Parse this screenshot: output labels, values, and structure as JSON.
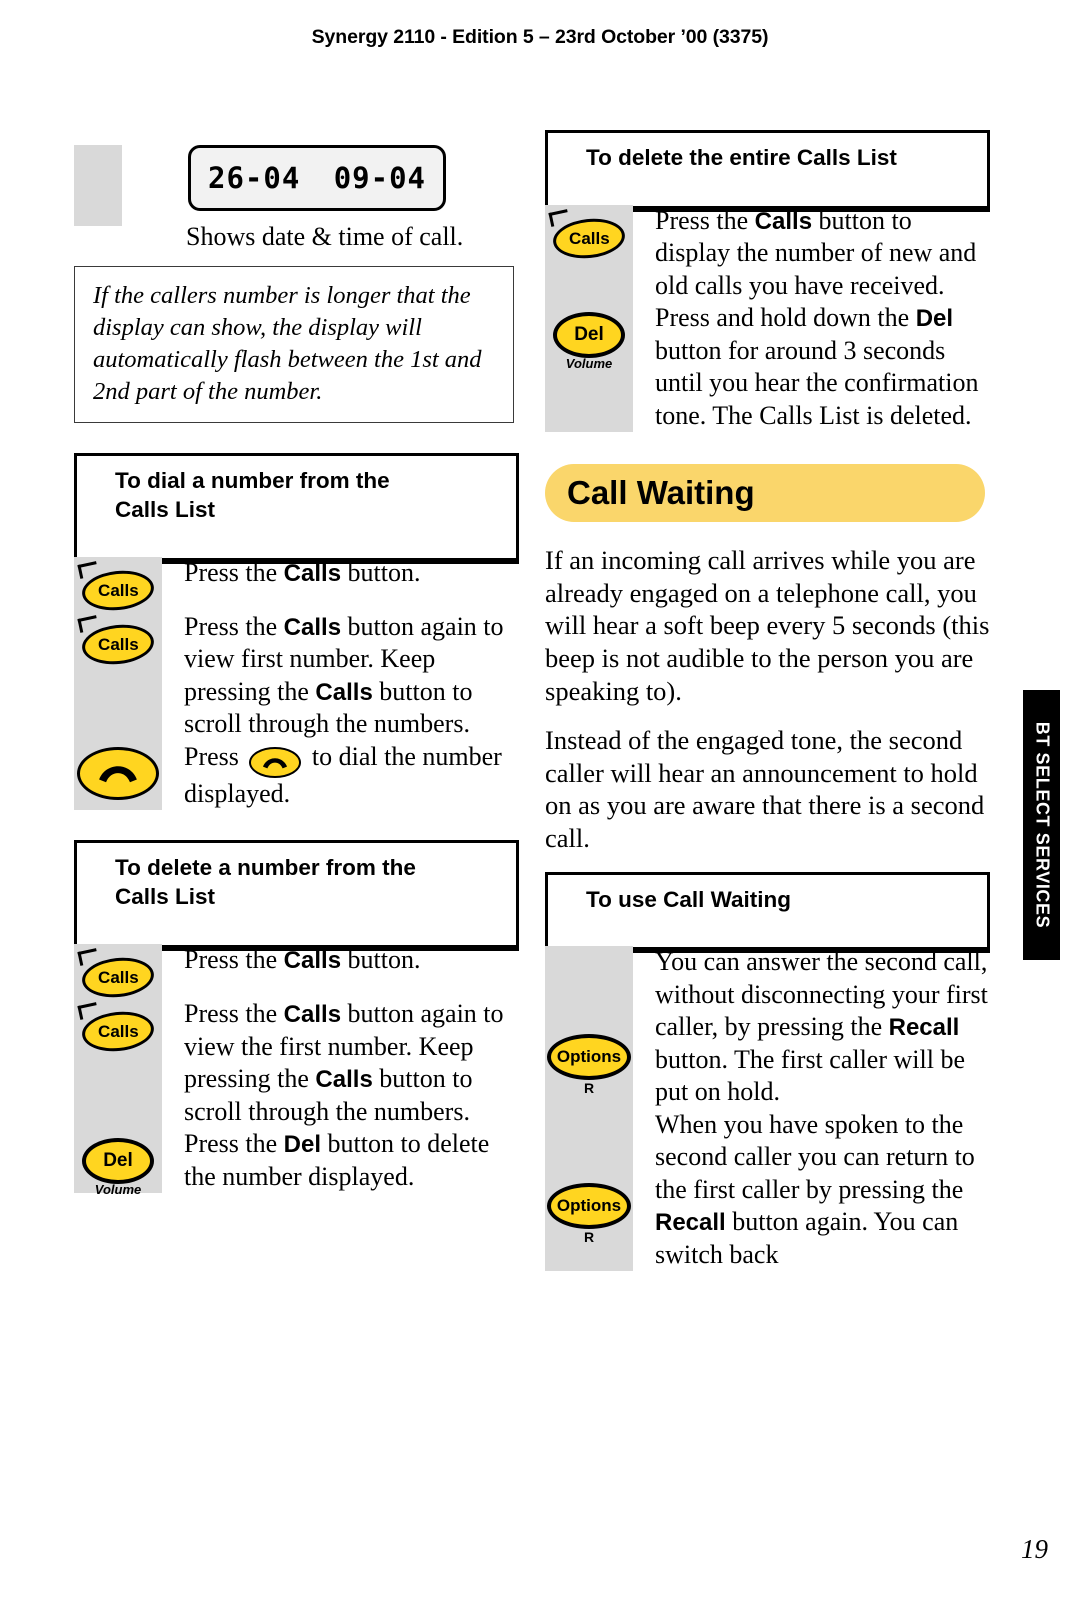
{
  "header": {
    "title": "Synergy 2110 - Edition 5 – 23rd October ’00 (3375)"
  },
  "page_number": "19",
  "side_tab": {
    "label": "BT SELECT SERVICES"
  },
  "colors": {
    "key_yellow": "#FFD520",
    "banner_yellow": "#FAD66B",
    "strip_grey": "#d9d9d9",
    "lcd_grey": "#f2f2f2"
  },
  "left_column": {
    "lcd": {
      "date": "26-04",
      "time": "09-04",
      "caption": "Shows date & time of call."
    },
    "note": "If the callers number is longer that the display can show, the display will automatically flash between the 1st and 2nd part of the number.",
    "sections": [
      {
        "heading": "To dial a number from the Calls List",
        "steps": [
          {
            "icon": "calls-key",
            "icon_label": "Calls",
            "text_html": "Press the <b>Calls</b> button."
          },
          {
            "icon": "calls-key",
            "icon_label": "Calls",
            "text_html": "Press the <b>Calls</b> button again to view first number. Keep pressing the <b>Calls</b> button to scroll through the numbers."
          },
          {
            "icon": "handset-key",
            "icon_label": "",
            "text_html": "Press <span class=\"key key-handset-sm\"><svg class=\"hs\" width=\"28\" height=\"15\" viewBox=\"0 0 28 15\"><path d=\"M2 11.6 C4 6.2 9 3.2 14 3.2 C19 3.2 24 6.2 26 11.6 L21.6 13.4 C20.2 9.8 17.4 7.6 14 7.6 C10.6 7.6 7.8 9.8 6.4 13.4 Z\" fill=\"#000\"/></svg></span> to dial the number displayed."
          }
        ]
      },
      {
        "heading": "To delete a number from the Calls List",
        "steps": [
          {
            "icon": "calls-key",
            "icon_label": "Calls",
            "text_html": "Press the <b>Calls</b> button."
          },
          {
            "icon": "calls-key",
            "icon_label": "Calls",
            "text_html": "Press the <b>Calls</b> button again to view the first number. Keep pressing the <b>Calls</b> button to scroll through the numbers."
          },
          {
            "icon": "del-key",
            "icon_label": "Del",
            "icon_sub": "Volume",
            "text_html": "Press the <b>Del</b> button to delete the number displayed."
          }
        ]
      }
    ]
  },
  "right_column": {
    "sections": [
      {
        "heading": "To delete the entire Calls List",
        "steps": [
          {
            "icon": "calls-key",
            "icon_label": "Calls",
            "text_html": "Press the <b>Calls</b> button to display the number of new and old calls you have received."
          },
          {
            "icon": "del-key",
            "icon_label": "Del",
            "icon_sub": "Volume",
            "text_html": "Press and hold down the <b>Del</b> button for around 3 seconds until you hear the confirmation tone. The Calls List is deleted."
          }
        ]
      }
    ],
    "banner": {
      "label": "Call Waiting"
    },
    "paragraphs": [
      "If an incoming call arrives while you are already engaged on a telephone call, you will hear a soft beep every 5 seconds (this beep is not audible to the person you are speaking to).",
      "Instead of the engaged tone, the second caller will hear an announcement to hold on as you are aware that there is a second call."
    ],
    "use_section": {
      "heading": "To use Call Waiting",
      "steps": [
        {
          "icon": "options-key",
          "icon_label": "Options",
          "icon_sub": "R",
          "text_html": "You can answer the second call, without disconnecting your first caller, by pressing the <b>Recall</b> button. The first caller will be put on hold."
        },
        {
          "icon": "options-key",
          "icon_label": "Options",
          "icon_sub": "R",
          "text_html": "When you have spoken to the second caller you can return to the first caller by pressing the <b>Recall</b> button again. You can switch back"
        }
      ]
    }
  }
}
